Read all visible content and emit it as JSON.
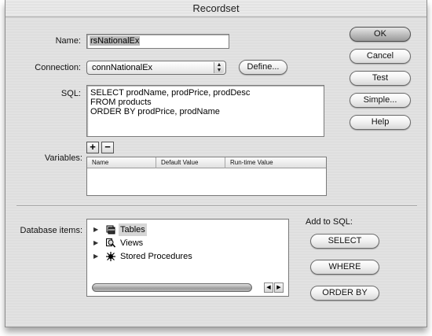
{
  "window": {
    "title": "Recordset"
  },
  "form": {
    "name_label": "Name:",
    "name_value": "rsNationalEx",
    "connection_label": "Connection:",
    "connection_value": "connNationalEx",
    "define_label": "Define...",
    "sql_label": "SQL:",
    "sql_lines": [
      "SELECT prodName, prodPrice, prodDesc",
      "FROM products",
      "ORDER BY prodPrice, prodName"
    ],
    "variables_label": "Variables:",
    "add_symbol": "+",
    "remove_symbol": "−",
    "variables_columns": [
      "Name",
      "Default Value",
      "Run-time Value"
    ]
  },
  "side_buttons": {
    "ok": "OK",
    "cancel": "Cancel",
    "test": "Test",
    "simple": "Simple...",
    "help": "Help"
  },
  "database": {
    "label": "Database items:",
    "items": [
      {
        "label": "Tables",
        "icon": "tables-icon"
      },
      {
        "label": "Views",
        "icon": "views-icon"
      },
      {
        "label": "Stored Procedures",
        "icon": "stored-procedures-icon"
      }
    ],
    "add_to_sql_label": "Add to SQL:",
    "select_label": "SELECT",
    "where_label": "WHERE",
    "orderby_label": "ORDER BY"
  }
}
